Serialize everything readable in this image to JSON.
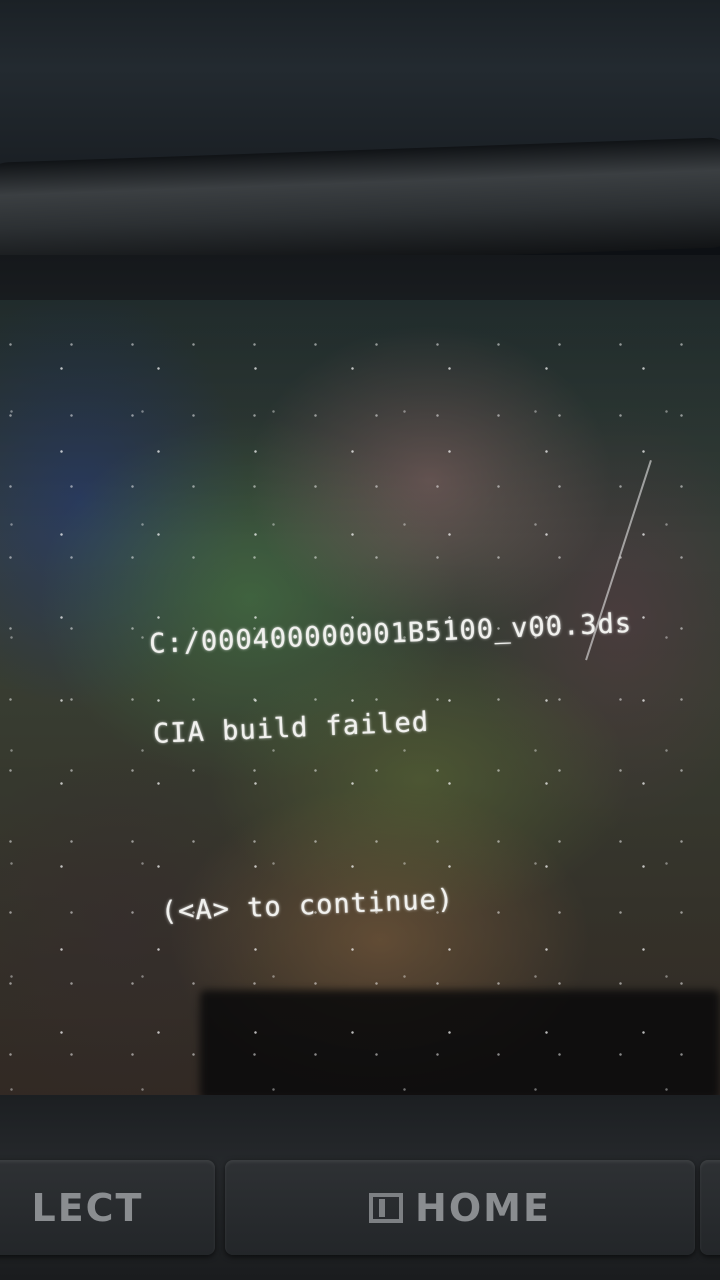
{
  "console": {
    "path": "C:/000400000001B5100_v00.3ds",
    "message": "CIA build failed",
    "prompt": "(<A> to continue)"
  },
  "buttons": {
    "select_label": "LECT",
    "home_label": "HOME"
  },
  "icons": {
    "home": "home-icon"
  },
  "colors": {
    "console_text": "#f1f1ee",
    "bezel": "#1c1f22"
  }
}
